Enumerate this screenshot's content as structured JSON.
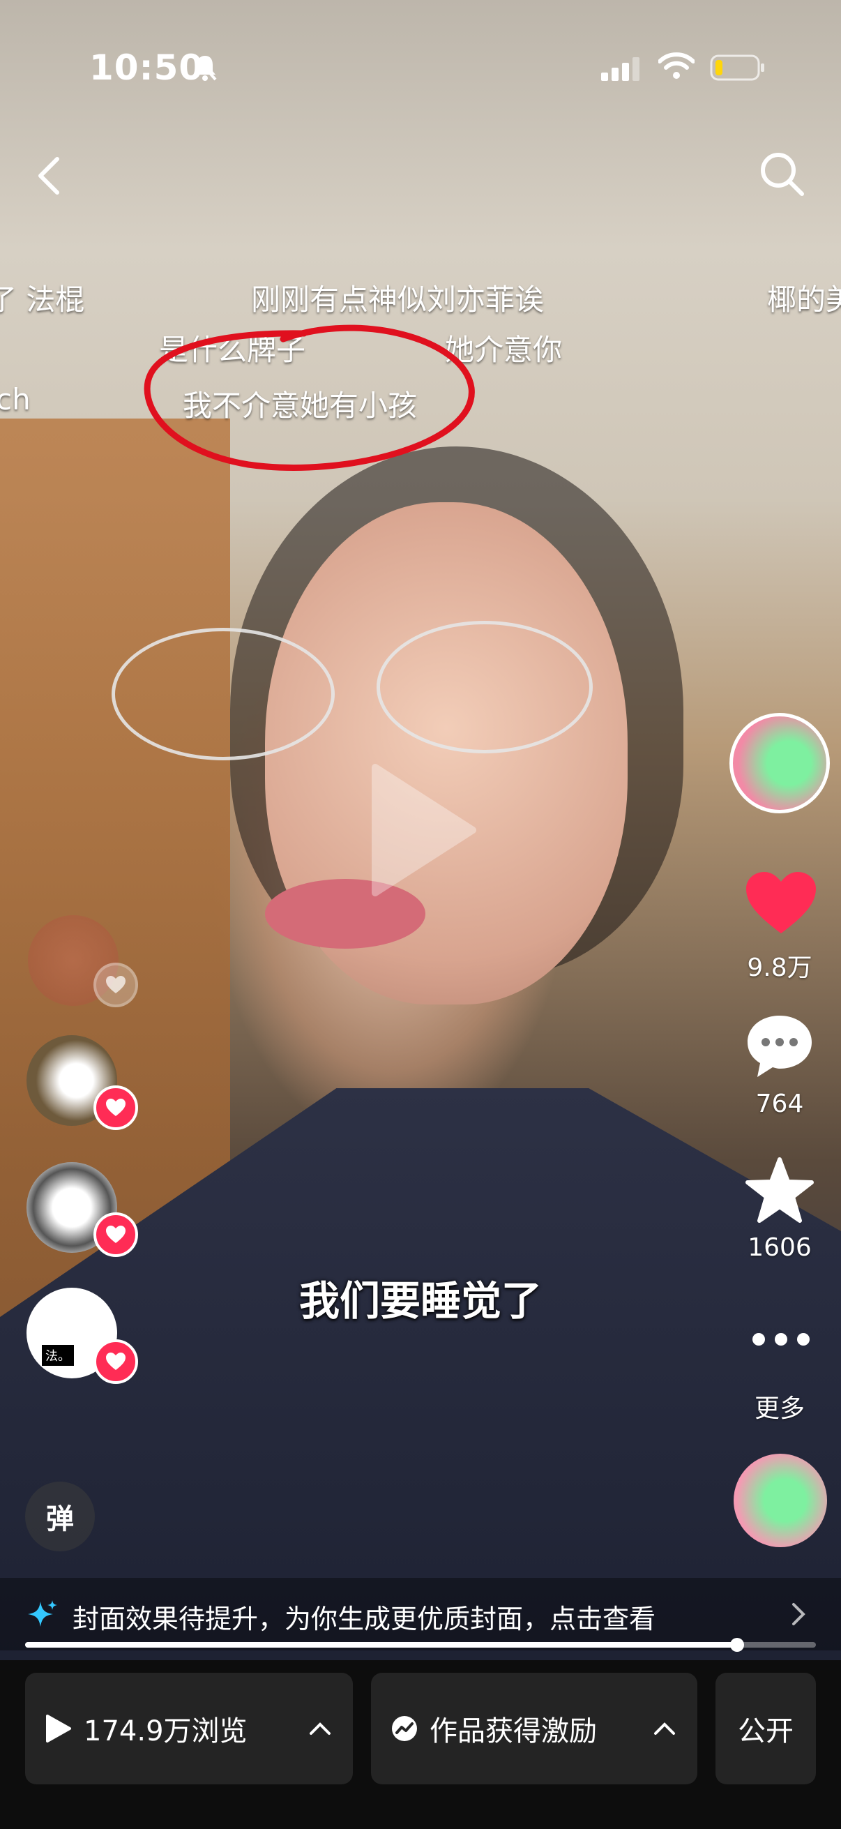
{
  "status_bar": {
    "time": "10:50",
    "mute_icon": "bell-slash-icon",
    "signal_icon": "signal-bars-icon",
    "wifi_icon": "wifi-icon",
    "battery_icon": "battery-low-icon",
    "battery_color": "#ffd60a"
  },
  "nav": {
    "back_icon": "chevron-left-icon",
    "search_icon": "search-icon"
  },
  "danmu": [
    "了 法棍",
    "刚刚有点神似刘亦菲诶",
    "椰的美",
    "是什么牌子",
    "她介意你",
    "ch",
    "我不介意她有小孩"
  ],
  "highlight_color": "#e0101e",
  "subtitle": "我们要睡觉了",
  "actions": {
    "like_count": "9.8万",
    "comment_count": "764",
    "favorite_count": "1606",
    "more_label": "更多",
    "like_color": "#ff2c55"
  },
  "liker_badge_text": "法。",
  "danmu_toggle_label": "弹",
  "cover_tip": {
    "text": "封面效果待提升，为你生成更优质封面，点击查看",
    "icon": "sparkle-icon"
  },
  "playback": {
    "progress": 0.9
  },
  "bottom_bar": {
    "views_label": "174.9万浏览",
    "reward_label": "作品获得激励",
    "public_label": "公开"
  }
}
